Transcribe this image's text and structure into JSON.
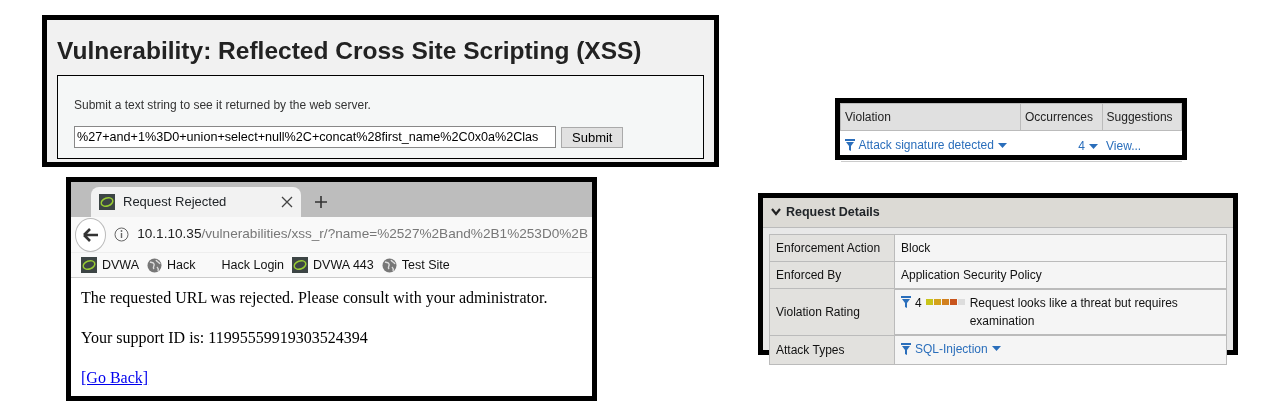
{
  "xss_panel": {
    "title": "Vulnerability: Reflected Cross Site Scripting (XSS)",
    "prompt": "Submit a text string to see it returned by the web server.",
    "input_value": "%27+and+1%3D0+union+select+null%2C+concat%28first_name%2C0x0a%2Clas",
    "submit_button": "Submit"
  },
  "browser": {
    "tab": {
      "title": "Request Rejected",
      "selected": true
    },
    "address": {
      "host": "10.1.10.35",
      "path": "/vulnerabilities/xss_r/?name=%2527%2Band%2B1%253D0%2B"
    },
    "bookmarks": [
      {
        "label": "DVWA",
        "kind": "app"
      },
      {
        "label": "Hack",
        "kind": "globe"
      },
      {
        "label": "Hack Login",
        "kind": "none"
      },
      {
        "label": "DVWA 443",
        "kind": "app"
      },
      {
        "label": "Test Site",
        "kind": "globe"
      }
    ],
    "message": "The requested URL was rejected. Please consult with your administrator.",
    "support_line": "Your support ID is: 11995559919303524394",
    "link": "[Go Back]"
  },
  "violations_table": {
    "columns": [
      "Violation",
      "Occurrences",
      "Suggestions"
    ],
    "rows": [
      {
        "violation": "Attack signature detected",
        "occurrences": "4",
        "suggestions": "View..."
      }
    ]
  },
  "request_details": {
    "title": "Request Details",
    "expanded": true,
    "rows": [
      {
        "label": "Enforcement Action",
        "kind": "text",
        "value": "Block"
      },
      {
        "label": "Enforced By",
        "kind": "text",
        "value": "Application Security Policy"
      },
      {
        "label": "Violation Rating",
        "kind": "rating",
        "rating": "4",
        "level": 0.8,
        "value": "Request looks like a threat but requires examination"
      },
      {
        "label": "Attack Types",
        "kind": "filter_link",
        "value": "SQL-Injection"
      }
    ]
  }
}
